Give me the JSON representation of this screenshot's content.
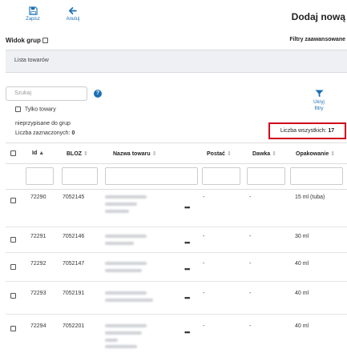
{
  "toolbar": {
    "save_label": "Zapisz",
    "cancel_label": "Anuluj",
    "save_icon": "floppy-disk-icon",
    "cancel_icon": "arrow-left-icon",
    "accent": "#1a6fb5"
  },
  "header": {
    "title": "Dodaj nową"
  },
  "view_toggle": {
    "label": "Widok grup",
    "checked": false
  },
  "advanced_filters_label": "Filtry zaawansowane",
  "product_list_title": "Lista towarów",
  "search": {
    "placeholder": "Szukaj",
    "value": ""
  },
  "filter_button": {
    "line1": "Ukryj",
    "line2": "filtry",
    "icon": "funnel-icon"
  },
  "only_ungrouped": {
    "label_line1": "Tylko towary",
    "label_line2": "nieprzypisane do grup",
    "checked": false
  },
  "selected_count": {
    "label": "Liczba zaznaczonych:",
    "value": "0"
  },
  "total_count": {
    "label": "Liczba wszystkich:",
    "value": "17",
    "highlight_color": "#d0021b"
  },
  "table": {
    "columns": [
      "Id",
      "BLOZ",
      "Nazwa towaru",
      "Postać",
      "Dawka",
      "Opakowanie"
    ],
    "rows": [
      {
        "id": "72290",
        "bloz": "7052145",
        "form": "-",
        "dose": "-",
        "package": "15 ml (tuba)"
      },
      {
        "id": "72291",
        "bloz": "7052146",
        "form": "-",
        "dose": "-",
        "package": "30 ml"
      },
      {
        "id": "72292",
        "bloz": "7052147",
        "form": "-",
        "dose": "-",
        "package": "40 ml"
      },
      {
        "id": "72293",
        "bloz": "7052191",
        "form": "-",
        "dose": "-",
        "package": "40 ml"
      },
      {
        "id": "72294",
        "bloz": "7052201",
        "form": "-",
        "dose": "-",
        "package": "40 ml"
      }
    ]
  }
}
